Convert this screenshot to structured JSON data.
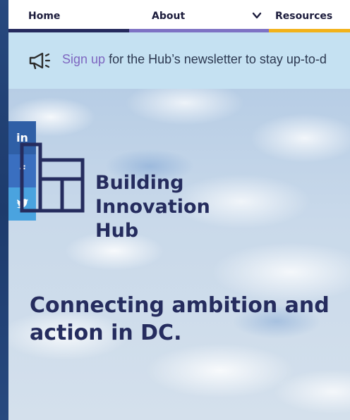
{
  "nav": {
    "items": [
      {
        "label": "Home"
      },
      {
        "label": "About"
      },
      {
        "label": "Resources"
      }
    ]
  },
  "banner": {
    "link_text": "Sign up",
    "text": " for the Hub’s newsletter to stay up-to-d"
  },
  "social": {
    "linkedin": "in",
    "facebook": "f"
  },
  "logo": {
    "line1": "Building",
    "line2": "Innovation",
    "line3": "Hub"
  },
  "hero": {
    "tagline_line1": "Connecting ambition and",
    "tagline_line2": "action in DC."
  },
  "colors": {
    "navy": "#252c5e",
    "purple": "#7e72c4",
    "yellow": "#f2b21a",
    "banner_bg": "#c5e1f2",
    "link": "#7e66c0"
  }
}
